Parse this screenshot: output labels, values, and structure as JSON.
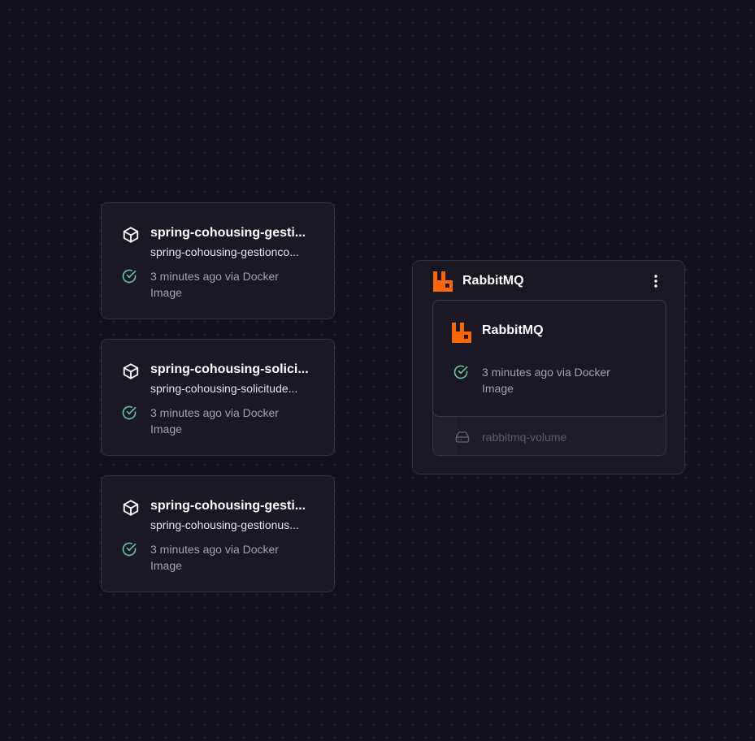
{
  "colors": {
    "background": "#13111c",
    "card": "#191824",
    "border": "#34323f",
    "success": "#64c29a",
    "rabbitmq_orange": "#ff6600"
  },
  "services": [
    {
      "icon": "box-icon",
      "name": "spring-cohousing-gestionco...",
      "title_display": "spring-cohousing-gesti...",
      "subtitle": "spring-cohousing-gestionco...",
      "status": "3 minutes ago via Docker Image"
    },
    {
      "icon": "box-icon",
      "title_display": "spring-cohousing-solici...",
      "subtitle": "spring-cohousing-solicitude...",
      "status": "3 minutes ago via Docker Image"
    },
    {
      "icon": "box-icon",
      "title_display": "spring-cohousing-gesti...",
      "subtitle": "spring-cohousing-gestionus...",
      "status": "3 minutes ago via Docker Image"
    }
  ],
  "rabbitmq_group": {
    "title": "RabbitMQ",
    "logo": "rabbitmq-logo",
    "menu_icon": "kebab-menu-icon",
    "service": {
      "title": "RabbitMQ",
      "status": "3 minutes ago via Docker Image"
    },
    "volume": {
      "icon": "hard-drive-icon",
      "label": "rabbitmq-volume"
    }
  }
}
